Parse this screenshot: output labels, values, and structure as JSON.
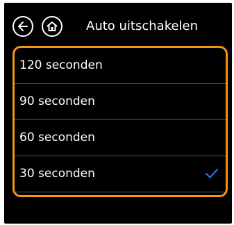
{
  "header": {
    "title": "Auto uitschakelen",
    "back_icon": "arrow-left-icon",
    "home_icon": "home-icon"
  },
  "options": [
    {
      "label": "120 seconden",
      "selected": false
    },
    {
      "label": "90 seconden",
      "selected": false
    },
    {
      "label": "60 seconden",
      "selected": false
    },
    {
      "label": "30 seconden",
      "selected": true
    }
  ],
  "colors": {
    "background": "#000000",
    "text": "#ffffff",
    "highlight_border": "#f39419",
    "checkmark": "#1a7be8",
    "divider": "#555555"
  }
}
